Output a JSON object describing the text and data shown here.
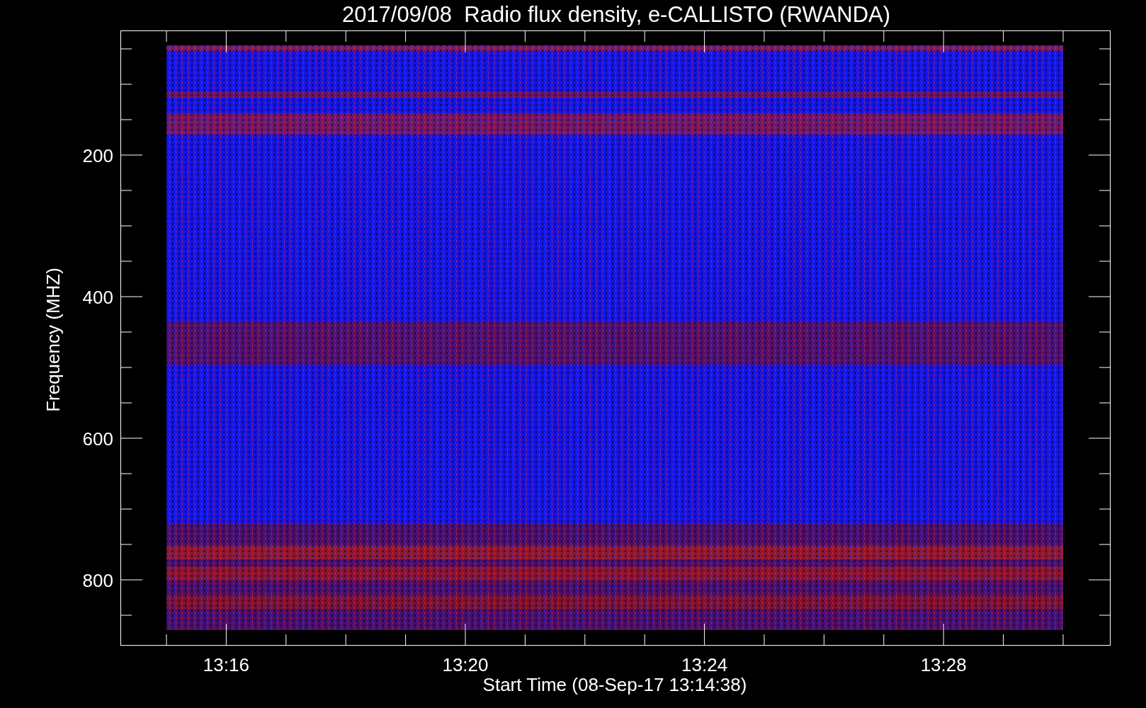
{
  "title": "2017/09/08  Radio flux density, e-CALLISTO (RWANDA)",
  "ylabel": "Frequency (MHZ)",
  "yticks": [
    "200",
    "400",
    "600",
    "800"
  ],
  "xticks": [
    "13:16",
    "13:20",
    "13:24",
    "13:28"
  ],
  "xlabel": "Start Time (08-Sep-17 13:14:38)"
}
